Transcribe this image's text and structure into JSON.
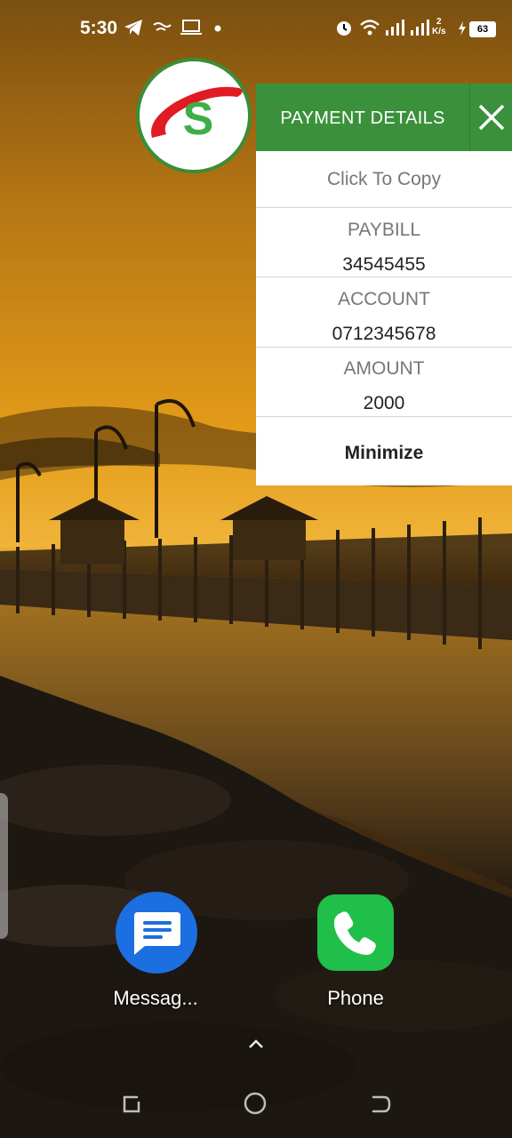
{
  "status_bar": {
    "time": "5:30",
    "speed_value": "2",
    "speed_unit": "K/s",
    "battery": "63"
  },
  "payment_panel": {
    "title": "PAYMENT DETAILS",
    "copy_hint": "Click To Copy",
    "paybill_label": "PAYBILL",
    "paybill_value": "34545455",
    "account_label": "ACCOUNT",
    "account_value": "0712345678",
    "amount_label": "AMOUNT",
    "amount_value": "2000",
    "minimize_label": "Minimize",
    "header_color": "#3b913b"
  },
  "home_apps": [
    {
      "label": "Messag...",
      "icon": "messages-icon"
    },
    {
      "label": "Phone",
      "icon": "phone-icon"
    }
  ],
  "icons": [
    "telegram-icon",
    "notification-icon",
    "laptop-icon",
    "alarm-icon",
    "wifi-icon",
    "signal-icon",
    "battery-icon",
    "close-icon",
    "chevron-up-icon",
    "recents-icon",
    "home-icon",
    "back-icon"
  ]
}
